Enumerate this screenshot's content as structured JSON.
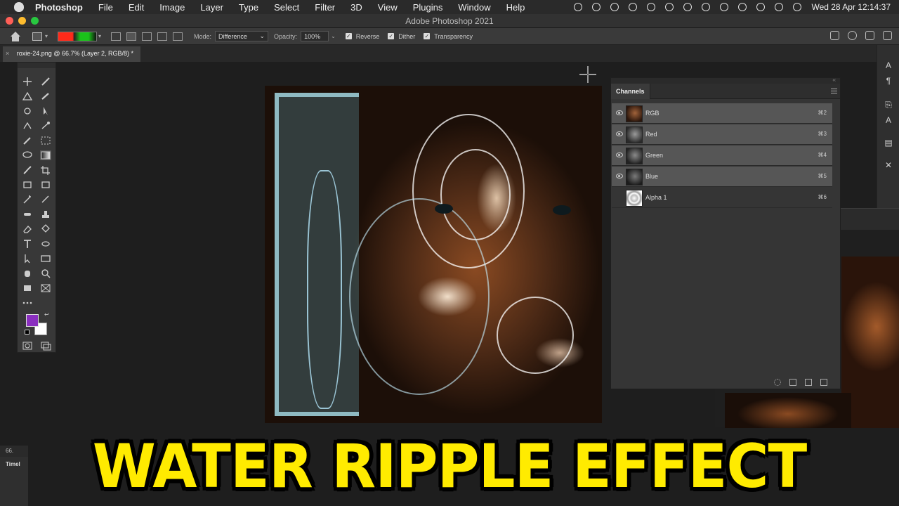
{
  "menubar": {
    "app_name": "Photoshop",
    "items": [
      "File",
      "Edit",
      "Image",
      "Layer",
      "Type",
      "Select",
      "Filter",
      "3D",
      "View",
      "Plugins",
      "Window",
      "Help"
    ],
    "clock": "Wed 28 Apr  12:14:37"
  },
  "window": {
    "title": "Adobe Photoshop 2021"
  },
  "options": {
    "mode_label": "Mode:",
    "mode_value": "Difference",
    "opacity_label": "Opacity:",
    "opacity_value": "100%",
    "reverse_label": "Reverse",
    "dither_label": "Dither",
    "transparency_label": "Transparency"
  },
  "document": {
    "tab_title": "roxie-24.png @ 66.7% (Layer 2, RGB/8) *",
    "close_symbol": "×"
  },
  "channels": {
    "panel_title": "Channels",
    "rows": [
      {
        "name": "RGB",
        "shortcut": "⌘2",
        "visible": true
      },
      {
        "name": "Red",
        "shortcut": "⌘3",
        "visible": true
      },
      {
        "name": "Green",
        "shortcut": "⌘4",
        "visible": true
      },
      {
        "name": "Blue",
        "shortcut": "⌘5",
        "visible": true
      },
      {
        "name": "Alpha 1",
        "shortcut": "⌘6",
        "visible": false
      }
    ]
  },
  "colors": {
    "foreground": "#8a2fbf",
    "background": "#ffffff",
    "headline": "#ffeb00"
  },
  "statusbar": {
    "zoom": "66.",
    "timeline_label": "Timel"
  },
  "headline": {
    "text": "WATER RIPPLE EFFECT"
  }
}
